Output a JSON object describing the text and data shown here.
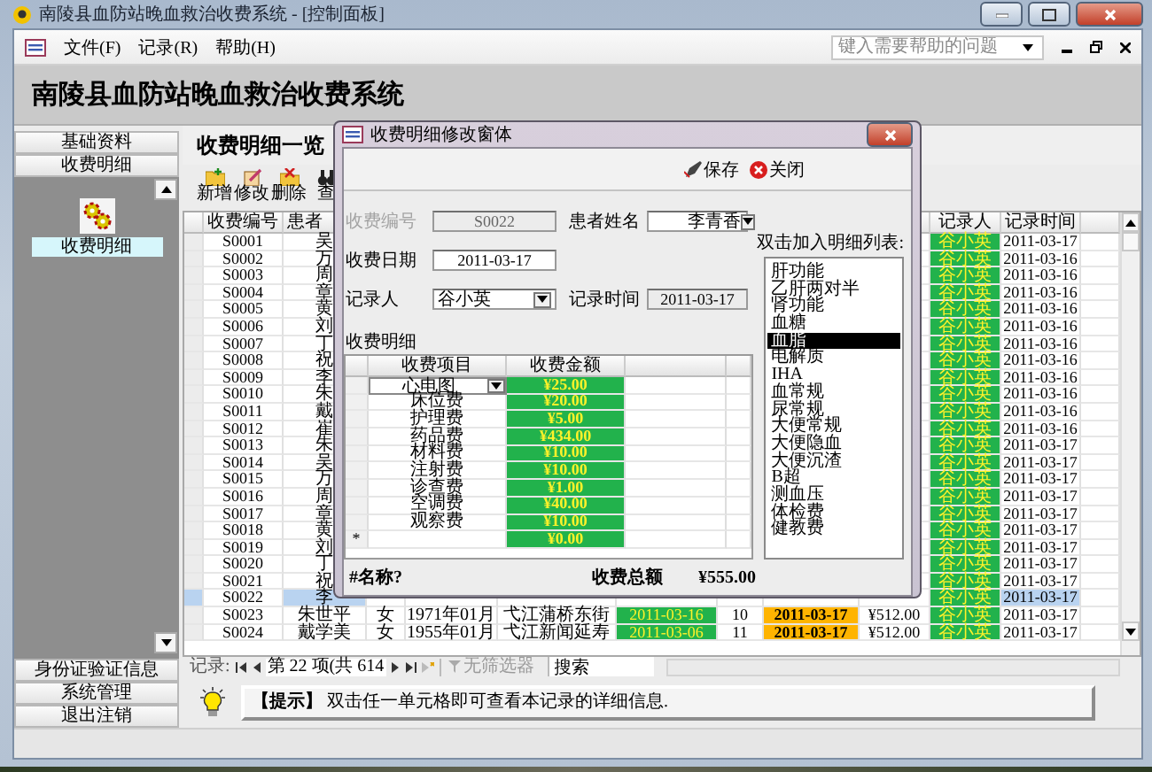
{
  "window": {
    "title": "南陵县血防站晚血救治收费系统 - [控制面板]"
  },
  "menu": {
    "items": [
      "文件(F)",
      "记录(R)",
      "帮助(H)"
    ],
    "help_search": {
      "placeholder": "键入需要帮助的问题"
    }
  },
  "header": {
    "title": "南陵县血防站晚血救治收费系统"
  },
  "sidebar": {
    "sections": [
      {
        "kind": "header",
        "label": "基础资料"
      },
      {
        "kind": "header",
        "label": "收费明细"
      },
      {
        "kind": "panel",
        "items": [
          {
            "label": "收费明细",
            "selected": true
          }
        ]
      },
      {
        "kind": "header",
        "label": "身份证验证信息"
      },
      {
        "kind": "header",
        "label": "系统管理"
      },
      {
        "kind": "header",
        "label": "退出注销"
      }
    ]
  },
  "main": {
    "heading": "收费明细一览",
    "toolbar": [
      "新增",
      "修改",
      "删除",
      "查"
    ],
    "table": {
      "columns": {
        "id": "收费编号",
        "name": "患者",
        "recorder": "记录人",
        "time": "记录时间"
      },
      "rows": [
        {
          "id": "S0001",
          "name": "吴",
          "recorder": "谷小英",
          "time": "2011-03-17",
          "selected": false
        },
        {
          "id": "S0002",
          "name": "万",
          "recorder": "谷小英",
          "time": "2011-03-16",
          "selected": false
        },
        {
          "id": "S0003",
          "name": "周",
          "recorder": "谷小英",
          "time": "2011-03-16",
          "selected": false
        },
        {
          "id": "S0004",
          "name": "章",
          "recorder": "谷小英",
          "time": "2011-03-16",
          "selected": false
        },
        {
          "id": "S0005",
          "name": "黄",
          "recorder": "谷小英",
          "time": "2011-03-16",
          "selected": false
        },
        {
          "id": "S0006",
          "name": "刘",
          "recorder": "谷小英",
          "time": "2011-03-16",
          "selected": false
        },
        {
          "id": "S0007",
          "name": "丁",
          "recorder": "谷小英",
          "time": "2011-03-16",
          "selected": false
        },
        {
          "id": "S0008",
          "name": "祝",
          "recorder": "谷小英",
          "time": "2011-03-16",
          "selected": false
        },
        {
          "id": "S0009",
          "name": "李",
          "recorder": "谷小英",
          "time": "2011-03-16",
          "selected": false
        },
        {
          "id": "S0010",
          "name": "朱",
          "recorder": "谷小英",
          "time": "2011-03-16",
          "selected": false
        },
        {
          "id": "S0011",
          "name": "戴",
          "recorder": "谷小英",
          "time": "2011-03-16",
          "selected": false
        },
        {
          "id": "S0012",
          "name": "崔",
          "recorder": "谷小英",
          "time": "2011-03-16",
          "selected": false
        },
        {
          "id": "S0013",
          "name": "朱",
          "recorder": "谷小英",
          "time": "2011-03-17",
          "selected": false
        },
        {
          "id": "S0014",
          "name": "吴",
          "recorder": "谷小英",
          "time": "2011-03-17",
          "selected": false
        },
        {
          "id": "S0015",
          "name": "万",
          "recorder": "谷小英",
          "time": "2011-03-17",
          "selected": false
        },
        {
          "id": "S0016",
          "name": "周",
          "recorder": "谷小英",
          "time": "2011-03-17",
          "selected": false
        },
        {
          "id": "S0017",
          "name": "章",
          "recorder": "谷小英",
          "time": "2011-03-17",
          "selected": false
        },
        {
          "id": "S0018",
          "name": "黄",
          "recorder": "谷小英",
          "time": "2011-03-17",
          "selected": false
        },
        {
          "id": "S0019",
          "name": "刘",
          "recorder": "谷小英",
          "time": "2011-03-17",
          "selected": false
        },
        {
          "id": "S0020",
          "name": "丁",
          "recorder": "谷小英",
          "time": "2011-03-17",
          "selected": false
        },
        {
          "id": "S0021",
          "name": "祝",
          "recorder": "谷小英",
          "time": "2011-03-17",
          "selected": false
        },
        {
          "id": "S0022",
          "name": "李",
          "recorder": "谷小英",
          "time": "2011-03-17",
          "selected": true
        },
        {
          "id": "S0023",
          "name": "朱世平",
          "column_3": "女",
          "column_4": "1971年01月",
          "column_5": "弋江蒲桥东街",
          "column_6": "2011-03-16",
          "column_7": "10",
          "column_8": "2011-03-17",
          "column_9": "¥512.00",
          "recorder": "谷小英",
          "time": "2011-03-17",
          "selected": false
        },
        {
          "id": "S0024",
          "name": "戴学美",
          "column_3": "女",
          "column_4": "1955年01月",
          "column_5": "弋江新闻延寿",
          "column_6": "2011-03-06",
          "column_7": "11",
          "column_8": "2011-03-17",
          "column_9": "¥512.00",
          "recorder": "谷小英",
          "time": "2011-03-17",
          "selected": false
        }
      ]
    },
    "record_nav": {
      "label": "记录:",
      "position": "第 22 项(共 614",
      "filter": "无筛选器",
      "search": "搜索"
    },
    "tip": "**【提示】** 双击任一单元格即可查看本记录的详细信息."
  },
  "dialog": {
    "title": "收费明细修改窗体",
    "toolbar": [
      "保存",
      "关闭"
    ],
    "fields": [
      {
        "label": "收费编号",
        "value": "S0022",
        "kind": "text",
        "disabled": true,
        "locked": true
      },
      {
        "label": "患者姓名",
        "value": "李青香",
        "kind": "combo",
        "disabled": false,
        "locked": false
      },
      {
        "label": "收费日期",
        "value": "2011-03-17",
        "kind": "text",
        "disabled": false,
        "locked": false
      },
      {
        "label": "记录人",
        "value": "谷小英",
        "kind": "combo",
        "disabled": false,
        "locked": false
      },
      {
        "label": "记录时间",
        "value": "2011-03-17",
        "kind": "text",
        "disabled": false,
        "locked": true
      }
    ],
    "detail": {
      "label": "收费明细",
      "columns": [
        "收费项目",
        "收费金额"
      ],
      "rows": [
        {
          "item": "心电图",
          "amount": "¥25.00",
          "kind": "combo"
        },
        {
          "item": "床位费",
          "amount": "¥20.00",
          "kind": "text"
        },
        {
          "item": "护理费",
          "amount": "¥5.00",
          "kind": "text"
        },
        {
          "item": "药品费",
          "amount": "¥434.00",
          "kind": "text"
        },
        {
          "item": "材料费",
          "amount": "¥10.00",
          "kind": "text"
        },
        {
          "item": "注射费",
          "amount": "¥10.00",
          "kind": "text"
        },
        {
          "item": "诊查费",
          "amount": "¥1.00",
          "kind": "text"
        },
        {
          "item": "空调费",
          "amount": "¥40.00",
          "kind": "text"
        },
        {
          "item": "观察费",
          "amount": "¥10.00",
          "kind": "text"
        }
      ],
      "new_row": {
        "marker": "*",
        "amount": "¥0.00"
      }
    },
    "list": {
      "label": "双击加入明细列表:",
      "items": [
        {
          "label": "肝功能",
          "selected": false
        },
        {
          "label": "乙肝两对半",
          "selected": false
        },
        {
          "label": "肾功能",
          "selected": false
        },
        {
          "label": "血糖",
          "selected": false
        },
        {
          "label": "血脂",
          "selected": true
        },
        {
          "label": "电解质",
          "selected": false
        },
        {
          "label": "IHA",
          "selected": false
        },
        {
          "label": "血常规",
          "selected": false
        },
        {
          "label": "尿常规",
          "selected": false
        },
        {
          "label": "大便常规",
          "selected": false
        },
        {
          "label": "大便隐血",
          "selected": false
        },
        {
          "label": "大便沉渣",
          "selected": false
        },
        {
          "label": "B超",
          "selected": false
        },
        {
          "label": "测血压",
          "selected": false
        },
        {
          "label": "体检费",
          "selected": false
        },
        {
          "label": "健教费",
          "selected": false
        }
      ]
    },
    "footer": {
      "error": "#名称?",
      "total_label": "收费总额",
      "total": "¥555.00"
    }
  }
}
